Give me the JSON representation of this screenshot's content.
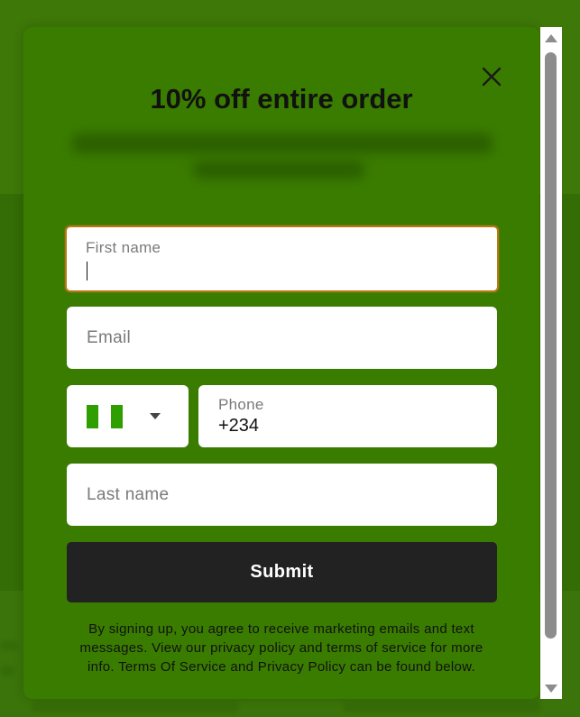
{
  "modal": {
    "title": "10% off entire order",
    "close_icon": "close-icon"
  },
  "form": {
    "first_name": {
      "label": "First name",
      "value": ""
    },
    "email": {
      "placeholder": "Email"
    },
    "country": {
      "flag_icon": "nigeria-flag-icon",
      "flag_colors": [
        "#2f9e00",
        "#ffffff",
        "#2f9e00"
      ]
    },
    "phone": {
      "label": "Phone",
      "value": "+234"
    },
    "last_name": {
      "placeholder": "Last name"
    },
    "submit_label": "Submit"
  },
  "disclaimer": "By signing up, you agree to receive marketing emails and text messages. View our privacy policy and terms of service for more info. Terms Of Service and Privacy Policy can be found below.",
  "colors": {
    "modal_bg": "#3a7c00",
    "focus_border": "#b87914",
    "button_bg": "#222222"
  }
}
